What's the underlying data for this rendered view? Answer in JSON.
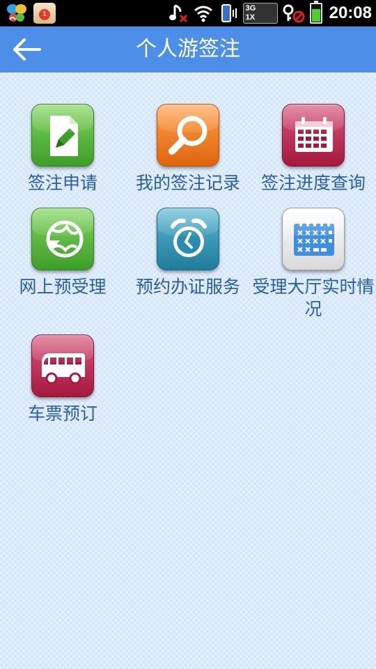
{
  "status_bar": {
    "notification_badge": "1",
    "network_3g": "3G",
    "network_1x": "1X",
    "time": "20:08"
  },
  "header": {
    "title": "个人游签注"
  },
  "tiles": [
    {
      "label": "签注申请",
      "icon": "document-edit-icon",
      "color": "#4caf2e"
    },
    {
      "label": "我的签注记录",
      "icon": "magnifier-icon",
      "color": "#f07a1e"
    },
    {
      "label": "签注进度查询",
      "icon": "calendar-icon",
      "color": "#b82150"
    },
    {
      "label": "网上预受理",
      "icon": "globe-arrow-icon",
      "color": "#4caf2e"
    },
    {
      "label": "预约办证服务",
      "icon": "alarm-clock-icon",
      "color": "#2a8caf"
    },
    {
      "label": "受理大厅实时情况",
      "icon": "schedule-calendar-icon",
      "color": "#3f8fe0"
    },
    {
      "label": "车票预订",
      "icon": "bus-icon",
      "color": "#b82150"
    }
  ]
}
